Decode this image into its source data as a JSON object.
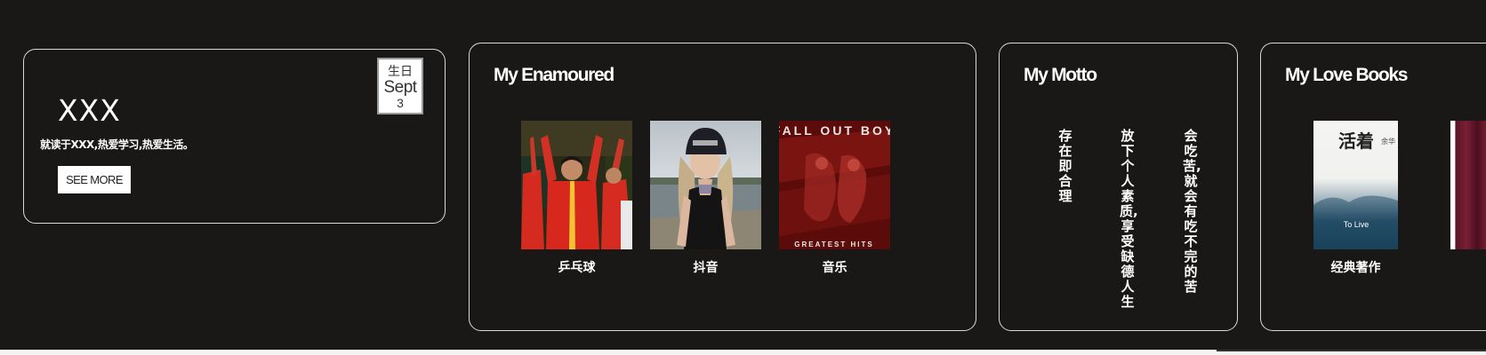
{
  "profile": {
    "name": "XXX",
    "bio": "就读于XXX,热爱学习,热爱生活。",
    "see_more_label": "SEE MORE",
    "birthday": {
      "label": "生日",
      "month": "Sept",
      "day": "3"
    }
  },
  "enamoured": {
    "title": "My Enamoured",
    "items": [
      {
        "caption": "乒乓球",
        "image": "table-tennis-players-photo"
      },
      {
        "caption": "抖音",
        "image": "woman-portrait-photo"
      },
      {
        "caption": "音乐",
        "image": "fall-out-boy-album-cover",
        "cover_text_top": "FALL OUT BOY",
        "cover_text_bottom": "GREATEST HITS"
      }
    ]
  },
  "motto": {
    "title": "My Motto",
    "lines": [
      "存在即合理",
      "放下个人素质,享受缺德人生",
      "会吃苦,就会有吃不完的苦"
    ]
  },
  "books": {
    "title": "My Love Books",
    "items": [
      {
        "caption": "经典著作",
        "cover_title": "活着",
        "cover_author": "余华",
        "cover_subtitle": "To Live"
      }
    ]
  },
  "colors": {
    "background": "#1a1817",
    "card_border": "#d9d9d9",
    "text": "#ffffff"
  }
}
